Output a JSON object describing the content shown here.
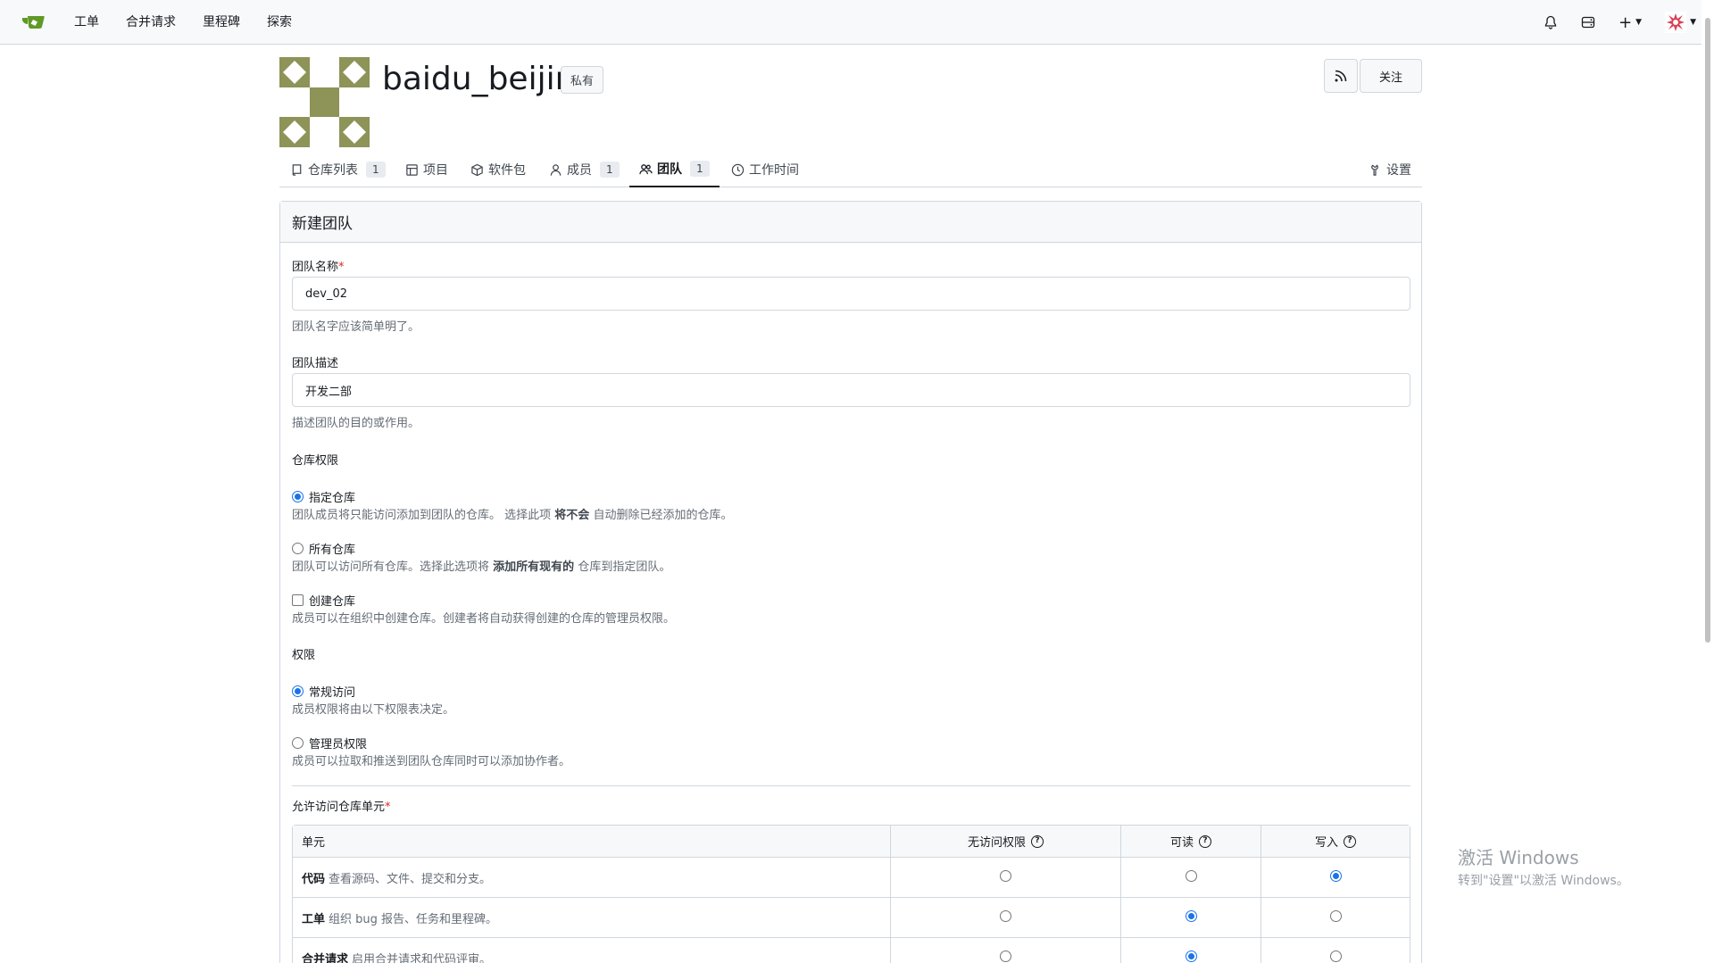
{
  "nav": {
    "items": [
      "工单",
      "合并请求",
      "里程碑",
      "探索"
    ],
    "plus_label": "+"
  },
  "org": {
    "name": "baidu_beijin",
    "private_label": "私有",
    "follow_label": "关注"
  },
  "tabs": [
    {
      "label": "仓库列表",
      "count": "1"
    },
    {
      "label": "项目"
    },
    {
      "label": "软件包"
    },
    {
      "label": "成员",
      "count": "1"
    },
    {
      "label": "团队",
      "count": "1"
    },
    {
      "label": "工作时间"
    },
    {
      "label": "设置"
    }
  ],
  "form": {
    "title": "新建团队",
    "team_name_label": "团队名称",
    "team_name_value": "dev_02",
    "team_name_help": "团队名字应该简单明了。",
    "team_desc_label": "团队描述",
    "team_desc_value": "开发二部",
    "team_desc_help": "描述团队的目的或作用。",
    "repo_perm_label": "仓库权限",
    "specific_repo": {
      "label": "指定仓库",
      "help_a": "团队成员将只能访问添加到团队的仓库。 选择此项",
      "help_b": "将不会",
      "help_c": "自动删除已经添加的仓库。"
    },
    "all_repo": {
      "label": "所有仓库",
      "help_a": "团队可以访问所有仓库。选择此选项将",
      "help_b": "添加所有现有的",
      "help_c": "仓库到指定团队。"
    },
    "create_repo": {
      "label": "创建仓库",
      "help": "成员可以在组织中创建仓库。创建者将自动获得创建的仓库的管理员权限。"
    },
    "perm_label": "权限",
    "normal_access": {
      "label": "常规访问",
      "help": "成员权限将由以下权限表决定。"
    },
    "admin_access": {
      "label": "管理员权限",
      "help": "成员可以拉取和推送到团队仓库同时可以添加协作者。"
    },
    "units_label": "允许访问仓库单元"
  },
  "units_table": {
    "headers": {
      "unit": "单元",
      "none": "无访问权限",
      "read": "可读",
      "write": "写入"
    },
    "rows": [
      {
        "name": "代码",
        "desc": "查看源码、文件、提交和分支。",
        "selected": "write"
      },
      {
        "name": "工单",
        "desc": "组织 bug 报告、任务和里程碑。",
        "selected": "read"
      },
      {
        "name": "合并请求",
        "desc": "启用合并请求和代码评审。",
        "selected": "read"
      }
    ]
  },
  "watermark": {
    "title": "激活 Windows",
    "subtitle": "转到\"设置\"以激活 Windows。"
  },
  "colors": {
    "accent": "#1a73e8",
    "avatar": "#8e9358",
    "logo": "#609926"
  }
}
